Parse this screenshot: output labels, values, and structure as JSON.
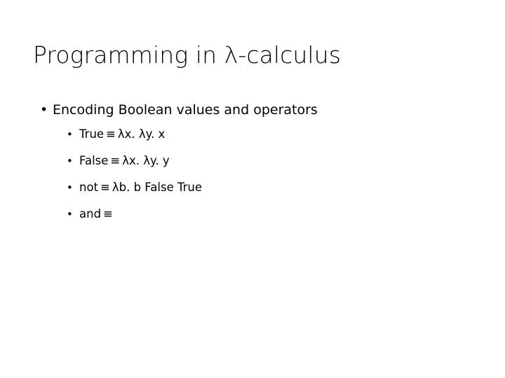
{
  "slide": {
    "title_prefix": "Programming in ",
    "title_lambda": "λ",
    "title_suffix": "-calculus",
    "title_full": "Programming in λ-calculus",
    "background_color": "#ffffff",
    "text_color": "#000000",
    "bullet_glyph_level1": "•",
    "bullet_glyph_level2": "•",
    "equiv_symbol": "≡"
  },
  "content": {
    "bullets": [
      {
        "label": "Encoding Boolean values and operators",
        "sub_bullets": [
          {
            "term": "True",
            "equiv": "≡",
            "definition": "λx. λy. x",
            "full": "True ≡ λx. λy. x"
          },
          {
            "term": "False",
            "equiv": "≡",
            "definition": "λx. λy. y",
            "full": "False ≡ λx. λy. y"
          },
          {
            "term": "not",
            "equiv": "≡",
            "definition": "λb. b False True",
            "full": "not ≡ λb. b False True"
          },
          {
            "term": "and",
            "equiv": "≡",
            "definition": "",
            "full": "and ≡"
          }
        ]
      }
    ]
  }
}
